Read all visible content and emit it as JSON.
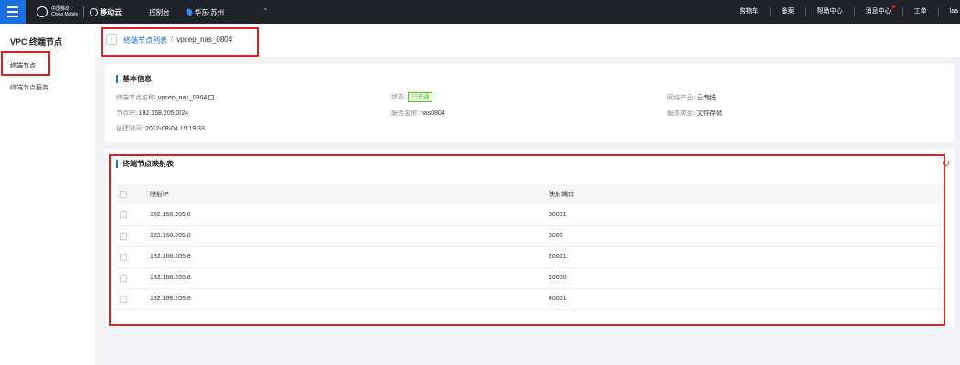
{
  "topbar": {
    "logo_small_line1": "中国移动",
    "logo_small_line2": "China Mobile",
    "brand": "移动云",
    "console": "控制台",
    "region": "华东-苏州",
    "right_items": [
      "购物车",
      "备案",
      "帮助中心",
      "消息中心",
      "工单",
      "laa"
    ]
  },
  "sidebar": {
    "title": "VPC 终端节点",
    "items": [
      "终端节点",
      "终端节点服务"
    ]
  },
  "breadcrumb": {
    "parent": "终端节点列表",
    "separator": "/",
    "current": "vpcep_nas_0804"
  },
  "basic_info": {
    "title": "基本信息",
    "name_label": "终端节点名称:",
    "name_value": "vpcep_nas_0804",
    "ip_label": "节点IP:",
    "ip_value": "192.168.205.0/24",
    "created_label": "创建时间:",
    "created_value": "2022-08-04 15:19:33",
    "status_label": "状态:",
    "status_value": "已开通",
    "service_name_label": "服务名称:",
    "service_name_value": "nas0804",
    "network_label": "网络产品:",
    "network_value": "云专线",
    "service_type_label": "服务类型:",
    "service_type_value": "文件存储"
  },
  "mapping": {
    "title": "终端节点映射表",
    "columns": [
      "映射IP",
      "映射端口"
    ],
    "rows": [
      {
        "ip": "192.168.205.8",
        "port": "30001"
      },
      {
        "ip": "192.168.205.8",
        "port": "8000"
      },
      {
        "ip": "192.168.205.8",
        "port": "20001"
      },
      {
        "ip": "192.168.205.8",
        "port": "10000"
      },
      {
        "ip": "192.168.205.8",
        "port": "40001"
      }
    ]
  }
}
